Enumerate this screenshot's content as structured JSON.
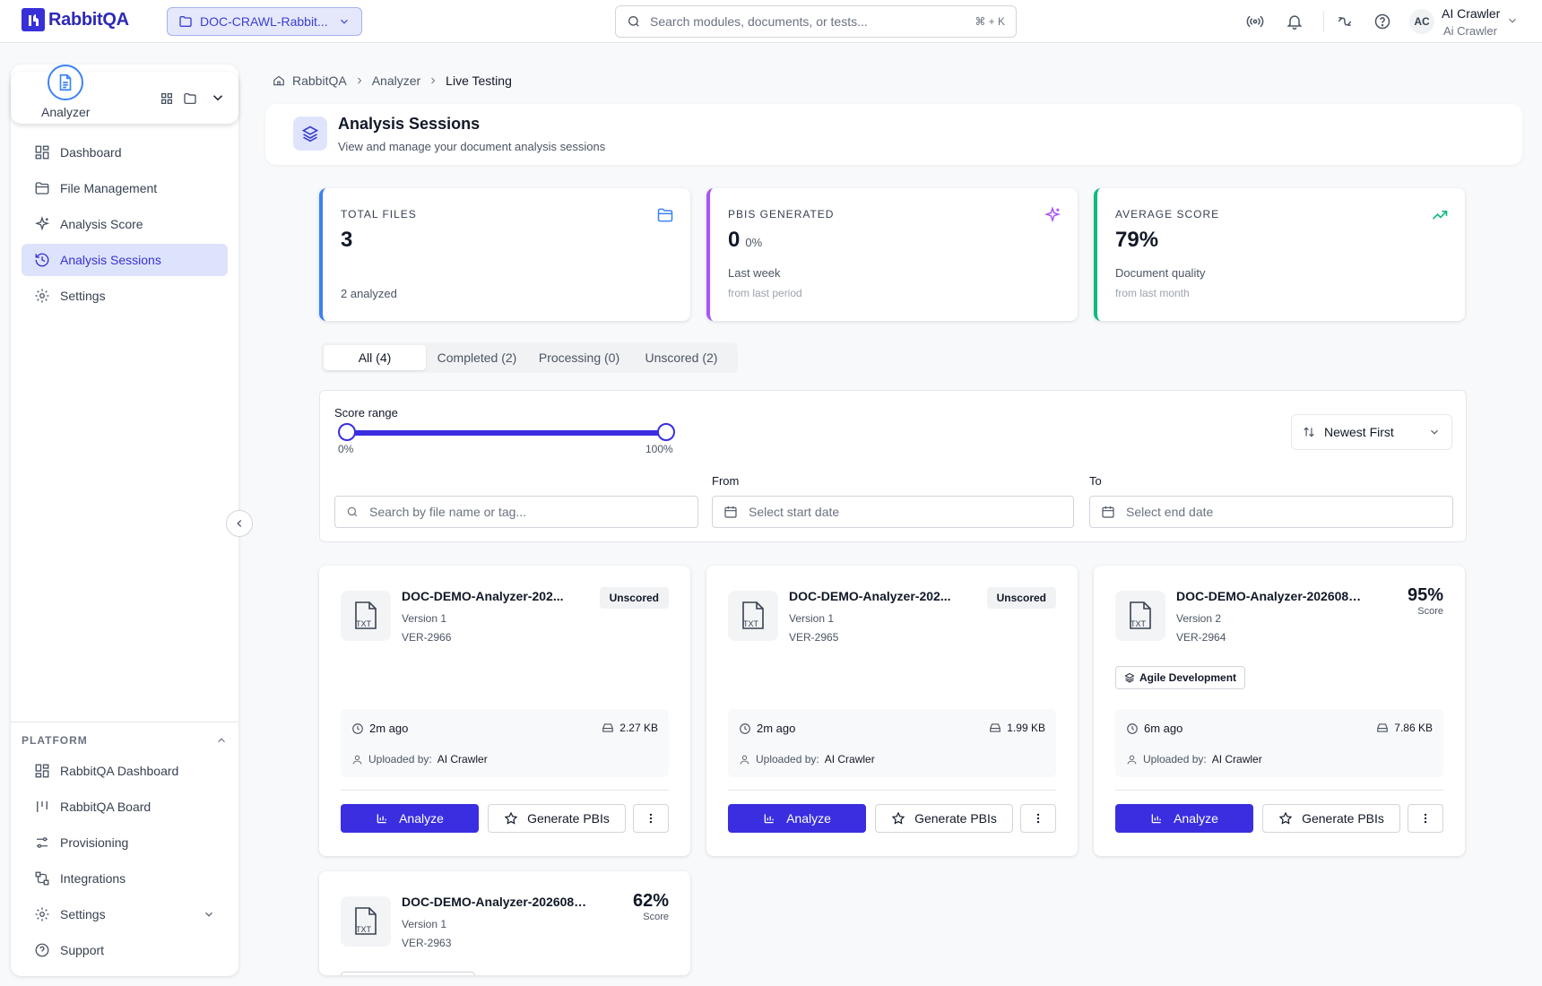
{
  "app": {
    "name": "RabbitQA"
  },
  "topbar": {
    "project": "DOC-CRAWL-Rabbit...",
    "search_placeholder": "Search modules, documents, or tests...",
    "shortcut": "⌘ + K",
    "user_initials": "AC",
    "user_name": "AI Crawler",
    "user_sub": "Ai Crawler"
  },
  "sidebar": {
    "module_label": "Analyzer",
    "items": [
      {
        "label": "Dashboard",
        "icon": "dashboard-icon"
      },
      {
        "label": "File Management",
        "icon": "folder-icon"
      },
      {
        "label": "Analysis Score",
        "icon": "sparkles-icon"
      },
      {
        "label": "Analysis Sessions",
        "icon": "history-icon",
        "active": true
      },
      {
        "label": "Settings",
        "icon": "gear-icon"
      }
    ],
    "platform_heading": "PLATFORM",
    "platform_items": [
      {
        "label": "RabbitQA Dashboard",
        "icon": "dashboard-icon"
      },
      {
        "label": "RabbitQA Board",
        "icon": "kanban-icon"
      },
      {
        "label": "Provisioning",
        "icon": "sliders-icon"
      },
      {
        "label": "Integrations",
        "icon": "integrations-icon"
      },
      {
        "label": "Settings",
        "icon": "gear-icon"
      },
      {
        "label": "Support",
        "icon": "help-icon"
      }
    ]
  },
  "breadcrumb": {
    "home": "RabbitQA",
    "section": "Analyzer",
    "current": "Live Testing"
  },
  "header": {
    "title": "Analysis Sessions",
    "subtitle": "View and manage your document analysis sessions"
  },
  "stats": {
    "total": {
      "label": "TOTAL FILES",
      "value": "3",
      "sub": "2 analyzed",
      "color": "#3b82f6"
    },
    "pbis": {
      "label": "PBIS GENERATED",
      "value": "0",
      "pct": "0%",
      "sub": "Last week",
      "sub2": "from last period",
      "color": "#a855f7"
    },
    "avg": {
      "label": "AVERAGE SCORE",
      "value": "79%",
      "sub": "Document quality",
      "sub2": "from last month",
      "color": "#10b981"
    }
  },
  "tabs": [
    "All (4)",
    "Completed (2)",
    "Processing (0)",
    "Unscored (2)"
  ],
  "filters": {
    "score_range_label": "Score range",
    "range_min": "0%",
    "range_max": "100%",
    "range_low": 0,
    "range_high": 100,
    "sort": "Newest First",
    "search_placeholder": "Search by file name or tag...",
    "from_label": "From",
    "from_placeholder": "Select start date",
    "to_label": "To",
    "to_placeholder": "Select end date"
  },
  "cards": [
    {
      "name": "DOC-DEMO-Analyzer-202...",
      "version": "Version 1",
      "id": "VER-2966",
      "badge": "Unscored",
      "time": "2m ago",
      "size": "2.27 KB",
      "uploaded_label": "Uploaded by:",
      "uploader": "AI Crawler"
    },
    {
      "name": "DOC-DEMO-Analyzer-202...",
      "version": "Version 1",
      "id": "VER-2965",
      "badge": "Unscored",
      "time": "2m ago",
      "size": "1.99 KB",
      "uploaded_label": "Uploaded by:",
      "uploader": "AI Crawler"
    },
    {
      "name": "DOC-DEMO-Analyzer-2026080...",
      "version": "Version 2",
      "id": "VER-2964",
      "score": "95%",
      "score_label": "Score",
      "tag": "Agile Development",
      "time": "6m ago",
      "size": "7.86 KB",
      "uploaded_label": "Uploaded by:",
      "uploader": "AI Crawler"
    },
    {
      "name": "DOC-DEMO-Analyzer-2026080...",
      "version": "Version 1",
      "id": "VER-2963",
      "score": "62%",
      "score_label": "Score"
    }
  ],
  "buttons": {
    "analyze": "Analyze",
    "generate": "Generate PBIs"
  }
}
